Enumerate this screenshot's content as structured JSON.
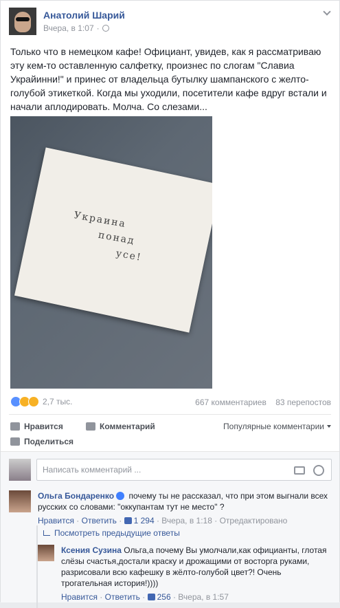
{
  "post": {
    "author": "Анатолий Шарий",
    "timestamp": "Вчера, в 1:07",
    "text": "Только что в немецком кафе! Официант, увидев, как я рассматриваю эту кем-то оставленную салфетку, произнес по слогам \"Славиа Украйинни!\" и принес от владельца бутылку шампанского с желто-голубой этикеткой. Когда мы уходили, посетители кафе вдруг встали и начали аплодировать. Молча. Со слезами...",
    "photo_text": [
      "Украина",
      "понад",
      "усе!"
    ]
  },
  "stats": {
    "reactions_count": "2,7 тыс.",
    "comments": "667 комментариев",
    "shares": "83 перепостов"
  },
  "actions": {
    "like": "Нравится",
    "comment": "Комментарий",
    "share": "Поделиться",
    "sort": "Популярные комментарии"
  },
  "composer": {
    "placeholder": "Написать комментарий ..."
  },
  "comments": [
    {
      "author": "Ольга Бондаренко",
      "text": "почему ты не рассказал, что при этом выгнали всех русских со словами: \"оккупантам тут не место\" ?",
      "like": "Нравится",
      "reply": "Ответить",
      "likes": "1 294",
      "time": "Вчера, в 1:18",
      "edited": "Отредактировано"
    }
  ],
  "previous_replies": "Посмотреть предыдущие ответы",
  "reply": {
    "author": "Ксения Сузина",
    "text": "Ольга,а почему Вы умолчали,как официанты, глотая слёзы счастья,достали краску и дрожащими от восторга руками, разрисовали всю кафешку в жёлто-голубой цвет?! Очень трогательная история!))))",
    "like": "Нравится",
    "reply": "Ответить",
    "likes": "256",
    "time": "Вчера, в 1:57"
  },
  "colors": {
    "link": "#365899",
    "muted": "#90949c",
    "like_blue": "#5890ff"
  }
}
